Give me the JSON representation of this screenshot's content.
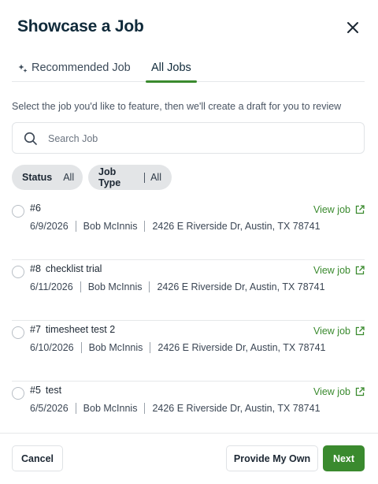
{
  "dialog": {
    "title": "Showcase a Job",
    "instructions": "Select the job you'd like to feature, then we'll create a draft for you to review"
  },
  "tabs": [
    {
      "label": "Recommended Job",
      "icon": "sparkle-icon",
      "active": false
    },
    {
      "label": "All Jobs",
      "active": true
    }
  ],
  "search": {
    "placeholder": "Search Job",
    "value": ""
  },
  "filters": {
    "status": {
      "label": "Status",
      "value": "All"
    },
    "job_type": {
      "label": "Job Type",
      "value": "All"
    }
  },
  "jobs": [
    {
      "number": "#6",
      "name": "",
      "date": "6/9/2026",
      "customer": "Bob McInnis",
      "address": "2426 E Riverside Dr, Austin, TX 78741",
      "link": "View job"
    },
    {
      "number": "#8",
      "name": "checklist trial",
      "date": "6/11/2026",
      "customer": "Bob McInnis",
      "address": "2426 E Riverside Dr, Austin, TX 78741",
      "link": "View job"
    },
    {
      "number": "#7",
      "name": "timesheet test 2",
      "date": "6/10/2026",
      "customer": "Bob McInnis",
      "address": "2426 E Riverside Dr, Austin, TX 78741",
      "link": "View job"
    },
    {
      "number": "#5",
      "name": "test",
      "date": "6/5/2026",
      "customer": "Bob McInnis",
      "address": "2426 E Riverside Dr, Austin, TX 78741",
      "link": "View job"
    }
  ],
  "footer": {
    "cancel_label": "Cancel",
    "provide_own_label": "Provide My Own",
    "next_label": "Next"
  },
  "colors": {
    "accent": "#3a8a2e",
    "title": "#102a3a",
    "chip_bg": "#e3e5e7"
  }
}
